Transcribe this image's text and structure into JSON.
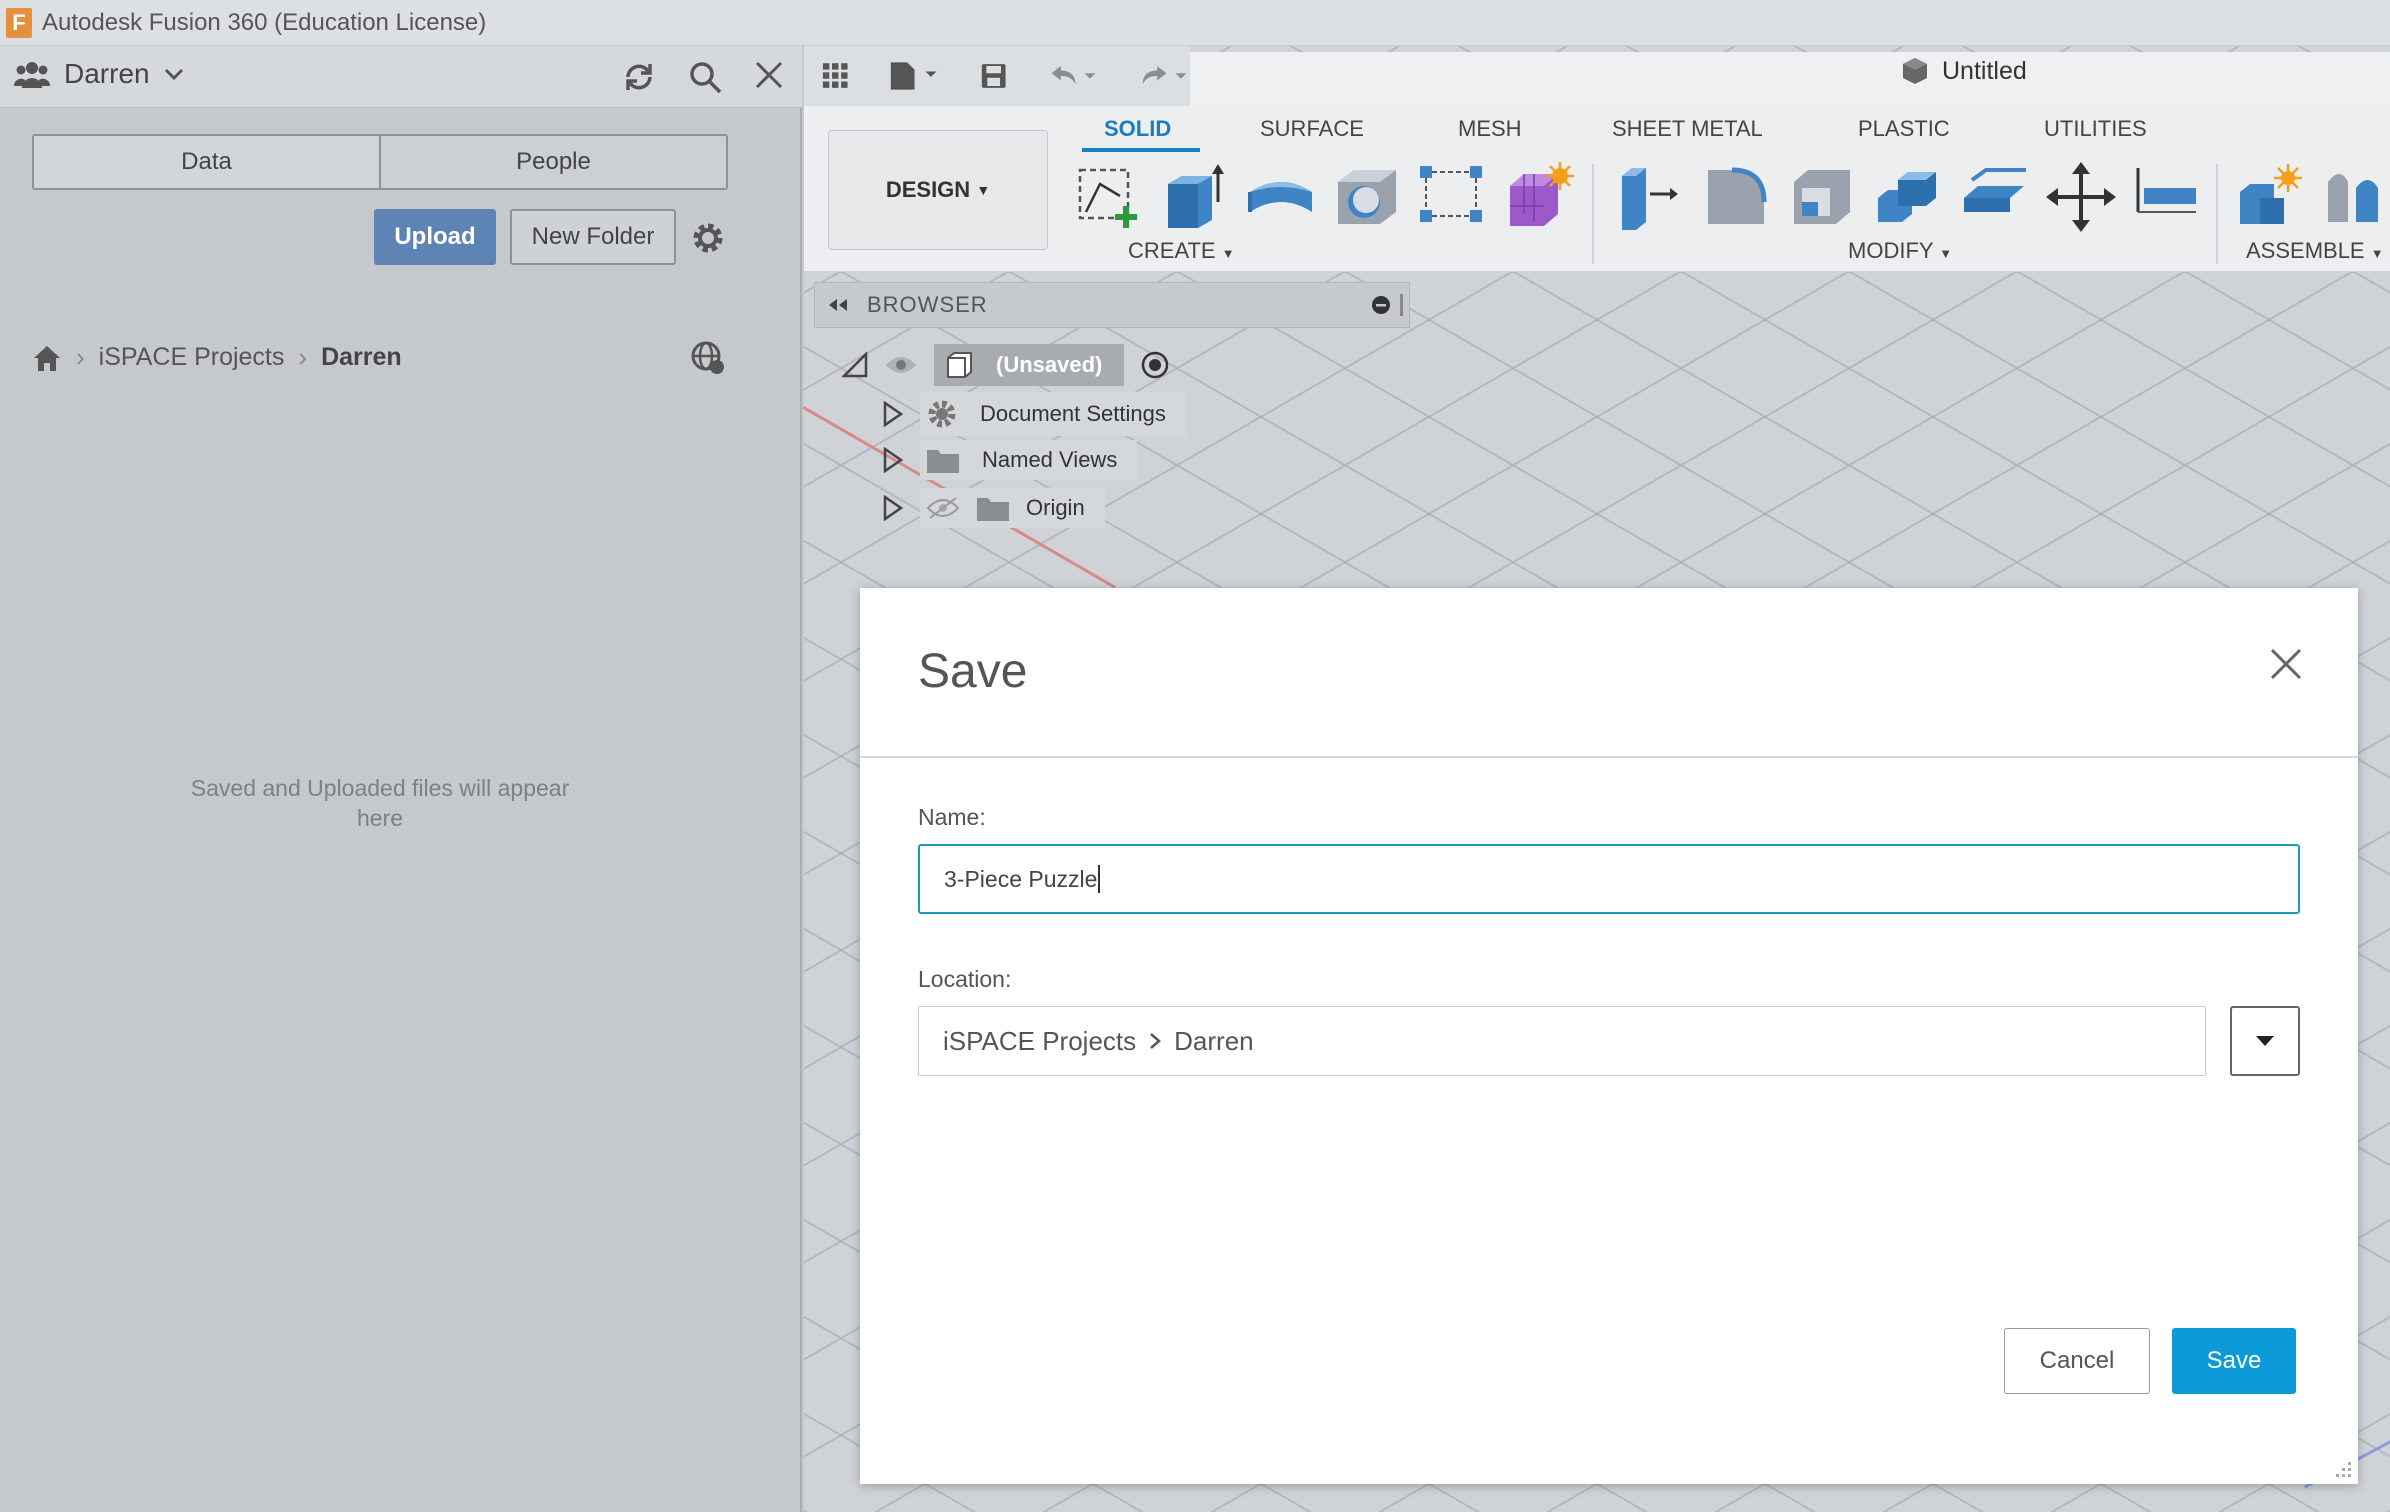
{
  "window": {
    "title": "Autodesk Fusion 360 (Education License)",
    "logo_letter": "F"
  },
  "data_panel": {
    "user_name": "Darren",
    "tabs": [
      "Data",
      "People"
    ],
    "upload_label": "Upload",
    "new_folder_label": "New Folder",
    "breadcrumb": {
      "project": "iSPACE Projects",
      "folder": "Darren"
    },
    "empty_message": "Saved and Uploaded files will appear here"
  },
  "document": {
    "tab_title": "Untitled"
  },
  "ribbon": {
    "workspace": "DESIGN",
    "tabs": [
      "SOLID",
      "SURFACE",
      "MESH",
      "SHEET METAL",
      "PLASTIC",
      "UTILITIES"
    ],
    "active_tab": "SOLID",
    "groups": [
      "CREATE",
      "MODIFY",
      "ASSEMBLE"
    ]
  },
  "browser": {
    "title": "BROWSER",
    "root": "(Unsaved)",
    "items": [
      "Document Settings",
      "Named Views",
      "Origin"
    ]
  },
  "save_dialog": {
    "title": "Save",
    "name_label": "Name:",
    "name_value": "3-Piece Puzzle",
    "location_label": "Location:",
    "location_project": "iSPACE Projects",
    "location_folder": "Darren",
    "cancel_label": "Cancel",
    "save_label": "Save"
  },
  "colors": {
    "accent": "#0d9ad8",
    "upload": "#5d84b4",
    "active_tab": "#1a7fc1",
    "input_focus": "#1a9cb8"
  },
  "icons": [
    "people-icon",
    "refresh-icon",
    "search-icon",
    "close-icon",
    "gear-icon",
    "home-icon",
    "globe-icon",
    "grid-icon",
    "file-icon",
    "save-icon",
    "undo-icon",
    "redo-icon",
    "cube-icon",
    "eye-icon",
    "target-icon",
    "folder-icon",
    "dropdown-icon"
  ]
}
